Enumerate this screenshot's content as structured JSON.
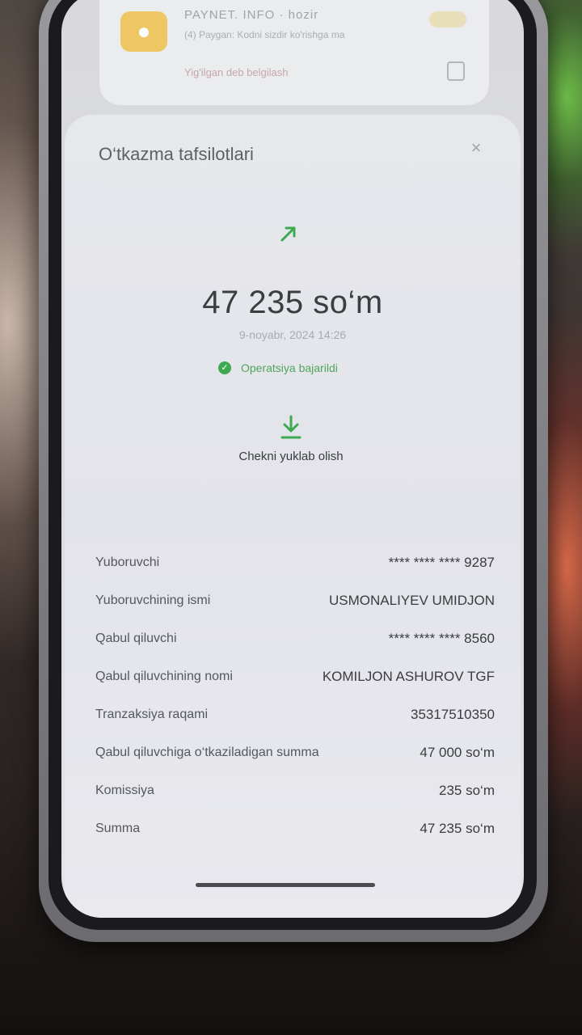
{
  "notification": {
    "title": "PAYNET. INFO",
    "time": "hozir",
    "text": "(4) Paygan: Kodni sizdir ko'rishga ma",
    "action": "Yig'ilgan deb belgilash"
  },
  "sheet": {
    "title": "O‘tkazma tafsilotlari",
    "close": "×",
    "amount": "47 235 so‘m",
    "date": "9-noyabr, 2024 14:26",
    "status": "Operatsiya bajarildi",
    "download_label": "Chekni yuklab olish"
  },
  "details": [
    {
      "label": "Yuboruvchi",
      "value": "**** **** **** 9287"
    },
    {
      "label": "Yuboruvchining ismi",
      "value": "USMONALIYEV UMIDJON"
    },
    {
      "label": "Qabul qiluvchi",
      "value": "**** **** **** 8560"
    },
    {
      "label": "Qabul qiluvchining nomi",
      "value": "KOMILJON ASHUROV TGF"
    },
    {
      "label": "Tranzaksiya raqami",
      "value": "35317510350"
    },
    {
      "label": "Qabul qiluvchiga o‘tkaziladigan summa",
      "value": "47 000 so‘m"
    },
    {
      "label": "Komissiya",
      "value": "235 so‘m"
    },
    {
      "label": "Summa",
      "value": "47 235 so‘m"
    }
  ],
  "colors": {
    "accent_green": "#3daa52",
    "text_dark": "#3a3c40"
  }
}
